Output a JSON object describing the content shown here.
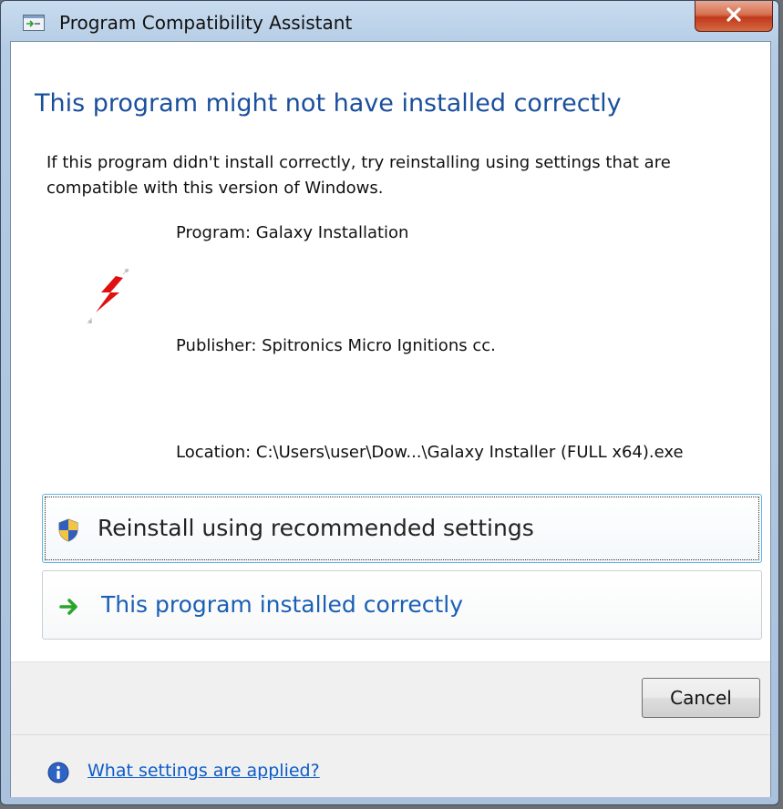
{
  "window": {
    "title": "Program Compatibility Assistant"
  },
  "heading": "This program might not have installed correctly",
  "intro": "If this program didn't install correctly, try reinstalling using settings that are compatible with this version of Windows.",
  "details": {
    "program": "Program: Galaxy Installation",
    "publisher": "Publisher: Spitronics Micro Ignitions cc.",
    "location": "Location: C:\\Users\\user\\Dow...\\Galaxy Installer (FULL x64).exe"
  },
  "options": {
    "reinstall_label": "Reinstall using recommended settings",
    "installed_label": "This program installed correctly"
  },
  "buttons": {
    "cancel_label": "Cancel"
  },
  "footer": {
    "link_label": "What settings are applied?"
  },
  "colors": {
    "heading": "#1a4f9c",
    "link": "#0b5cc9",
    "close_button": "#c0391c"
  },
  "icons": {
    "title": "app-window-icon",
    "program": "lightning-bolt-icon",
    "reinstall": "uac-shield-icon",
    "installed": "green-arrow-icon",
    "info": "info-icon"
  }
}
